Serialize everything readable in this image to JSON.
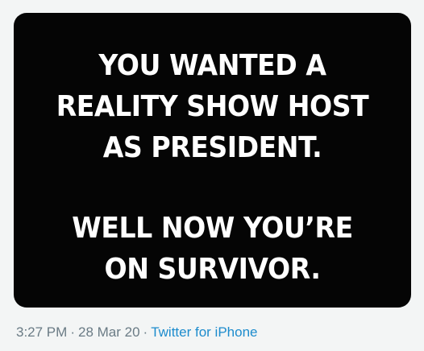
{
  "media": {
    "block_1": [
      "YOU WANTED A",
      "REALITY SHOW HOST",
      "AS PRESIDENT."
    ],
    "block_2": [
      "WELL NOW YOU’RE",
      "ON SURVIVOR."
    ]
  },
  "meta": {
    "time": "3:27 PM",
    "date": "28 Mar 20",
    "separator": "·",
    "source": "Twitter for iPhone"
  },
  "colors": {
    "page_background": "#f3f5f5",
    "card_background": "#050505",
    "meme_text": "#ffffff",
    "meta_text": "#6a7b85",
    "link": "#1d8ccd"
  }
}
